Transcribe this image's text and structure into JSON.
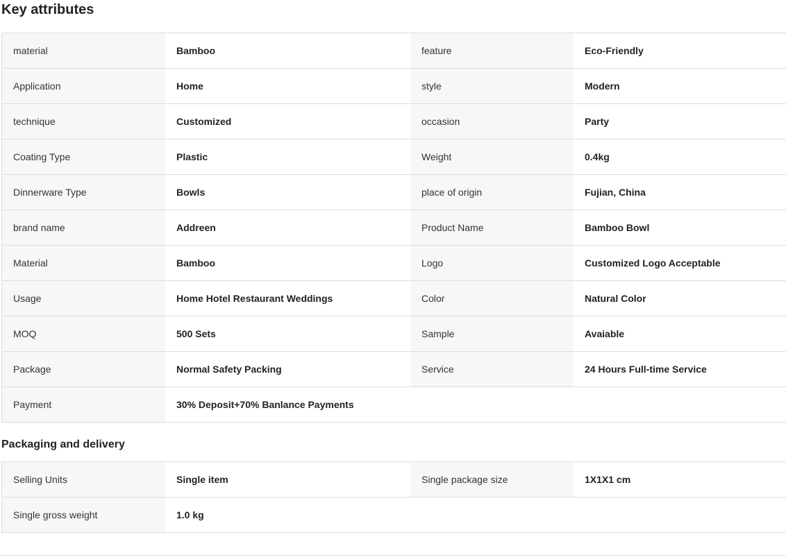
{
  "key_attributes": {
    "title": "Key attributes",
    "rows": [
      {
        "label1": "material",
        "value1": "Bamboo",
        "label2": "feature",
        "value2": "Eco-Friendly"
      },
      {
        "label1": "Application",
        "value1": "Home",
        "label2": "style",
        "value2": "Modern"
      },
      {
        "label1": "technique",
        "value1": "Customized",
        "label2": "occasion",
        "value2": "Party"
      },
      {
        "label1": "Coating Type",
        "value1": "Plastic",
        "label2": "Weight",
        "value2": "0.4kg"
      },
      {
        "label1": "Dinnerware Type",
        "value1": "Bowls",
        "label2": "place of origin",
        "value2": "Fujian, China"
      },
      {
        "label1": "brand name",
        "value1": "Addreen",
        "label2": "Product Name",
        "value2": "Bamboo Bowl"
      },
      {
        "label1": "Material",
        "value1": "Bamboo",
        "label2": "Logo",
        "value2": "Customized Logo Acceptable"
      },
      {
        "label1": "Usage",
        "value1": "Home Hotel Restaurant Weddings",
        "label2": "Color",
        "value2": "Natural Color"
      },
      {
        "label1": "MOQ",
        "value1": "500 Sets",
        "label2": "Sample",
        "value2": "Avaiable"
      },
      {
        "label1": "Package",
        "value1": "Normal Safety Packing",
        "label2": "Service",
        "value2": "24 Hours Full-time Service"
      },
      {
        "label1": "Payment",
        "value1": "30% Deposit+70% Banlance Payments",
        "label2": "",
        "value2": ""
      }
    ]
  },
  "packaging": {
    "title": "Packaging and delivery",
    "rows": [
      {
        "label1": "Selling Units",
        "value1": "Single item",
        "label2": "Single package size",
        "value2": "1X1X1 cm"
      },
      {
        "label1": "Single gross weight",
        "value1": "1.0 kg",
        "label2": "",
        "value2": ""
      }
    ]
  }
}
